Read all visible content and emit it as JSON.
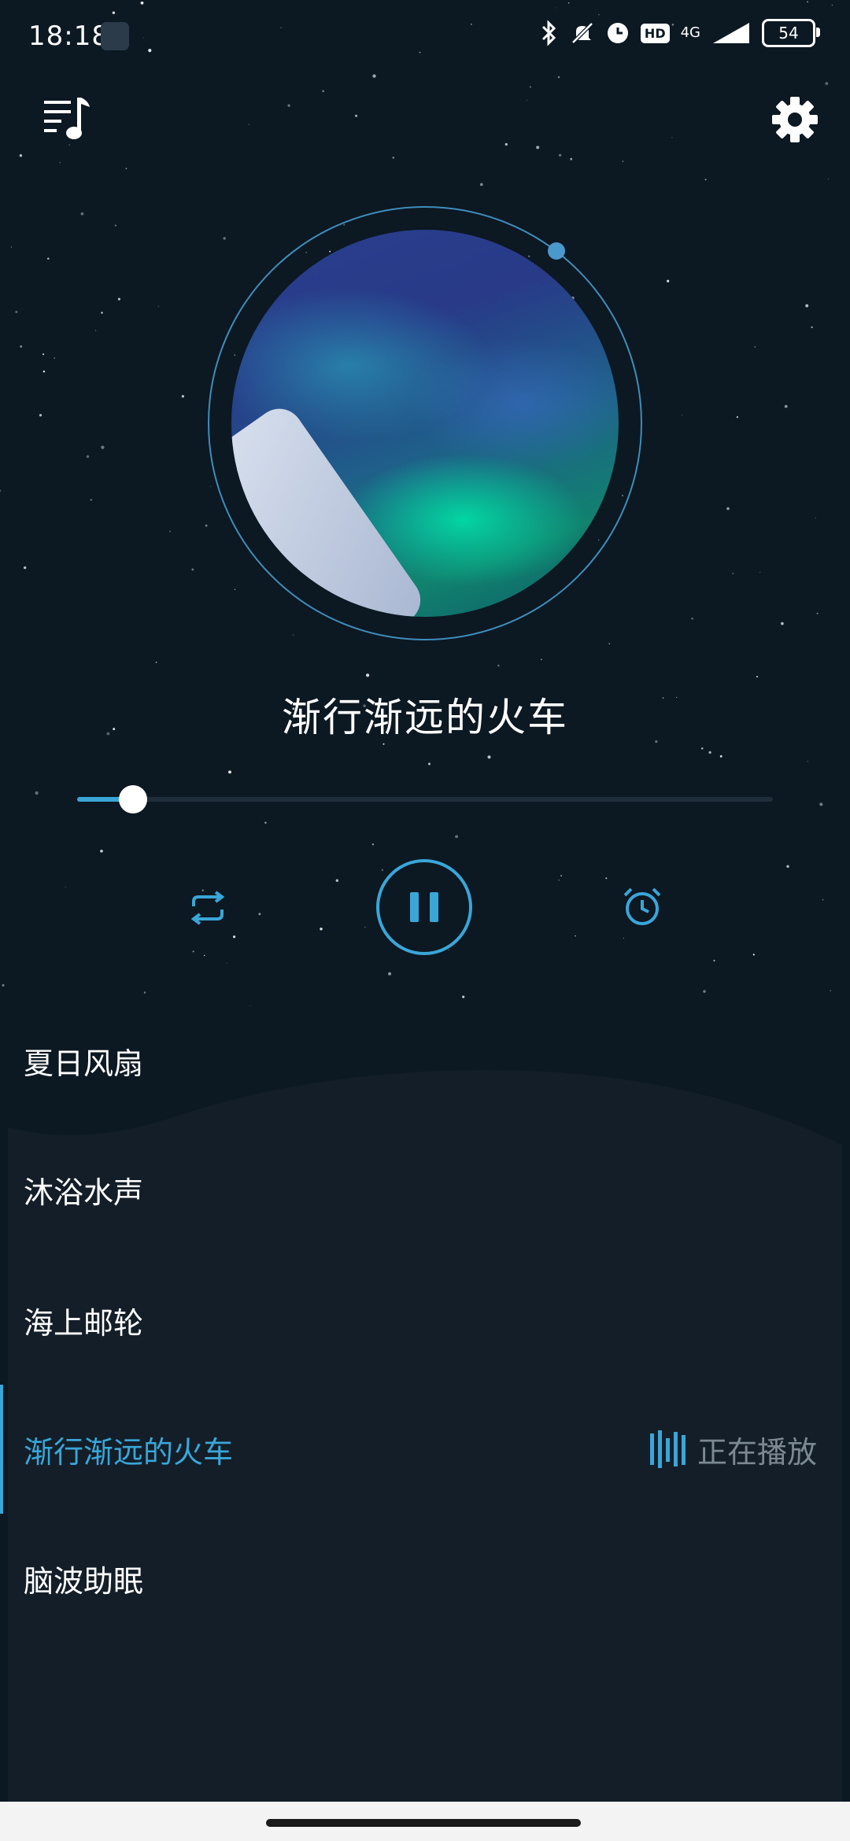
{
  "status_bar": {
    "time": "18:18",
    "network": "4G",
    "battery": "54"
  },
  "header": {
    "left_icon": "playlist-music-icon",
    "right_icon": "gear-icon"
  },
  "player": {
    "title": "渐行渐远的火车",
    "progress": 0.08,
    "controls": {
      "repeat_icon": "repeat-icon",
      "play_state": "pause-icon",
      "timer_icon": "alarm-clock-icon"
    }
  },
  "playlist": {
    "items": [
      {
        "label": "夏日风扇"
      },
      {
        "label": "沐浴水声"
      },
      {
        "label": "海上邮轮"
      },
      {
        "label": "渐行渐远的火车"
      },
      {
        "label": "脑波助眠"
      }
    ],
    "active_index": 3,
    "now_playing_label": "正在播放"
  },
  "colors": {
    "accent": "#3aa6d8",
    "background": "#0c1822",
    "list_background": "#131e28"
  }
}
